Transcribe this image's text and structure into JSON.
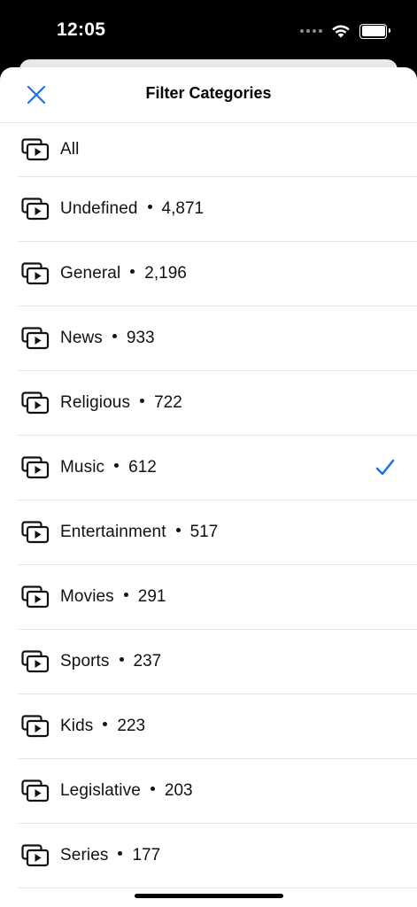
{
  "status_bar": {
    "time": "12:05",
    "icons": [
      "signal-dots-icon",
      "wifi-icon",
      "battery-icon"
    ]
  },
  "header": {
    "title": "Filter Categories",
    "close_icon": "close-icon"
  },
  "colors": {
    "accent": "#1a73e8",
    "separator": "#e4e4e6"
  },
  "categories": [
    {
      "label": "All",
      "count": "",
      "selected": false
    },
    {
      "label": "Undefined",
      "count": "4,871",
      "selected": false
    },
    {
      "label": "General",
      "count": "2,196",
      "selected": false
    },
    {
      "label": "News",
      "count": "933",
      "selected": false
    },
    {
      "label": "Religious",
      "count": "722",
      "selected": false
    },
    {
      "label": "Music",
      "count": "612",
      "selected": true
    },
    {
      "label": "Entertainment",
      "count": "517",
      "selected": false
    },
    {
      "label": "Movies",
      "count": "291",
      "selected": false
    },
    {
      "label": "Sports",
      "count": "237",
      "selected": false
    },
    {
      "label": "Kids",
      "count": "223",
      "selected": false
    },
    {
      "label": "Legislative",
      "count": "203",
      "selected": false
    },
    {
      "label": "Series",
      "count": "177",
      "selected": false
    }
  ],
  "row_icon": "video-library-icon",
  "selected_icon": "checkmark-icon"
}
